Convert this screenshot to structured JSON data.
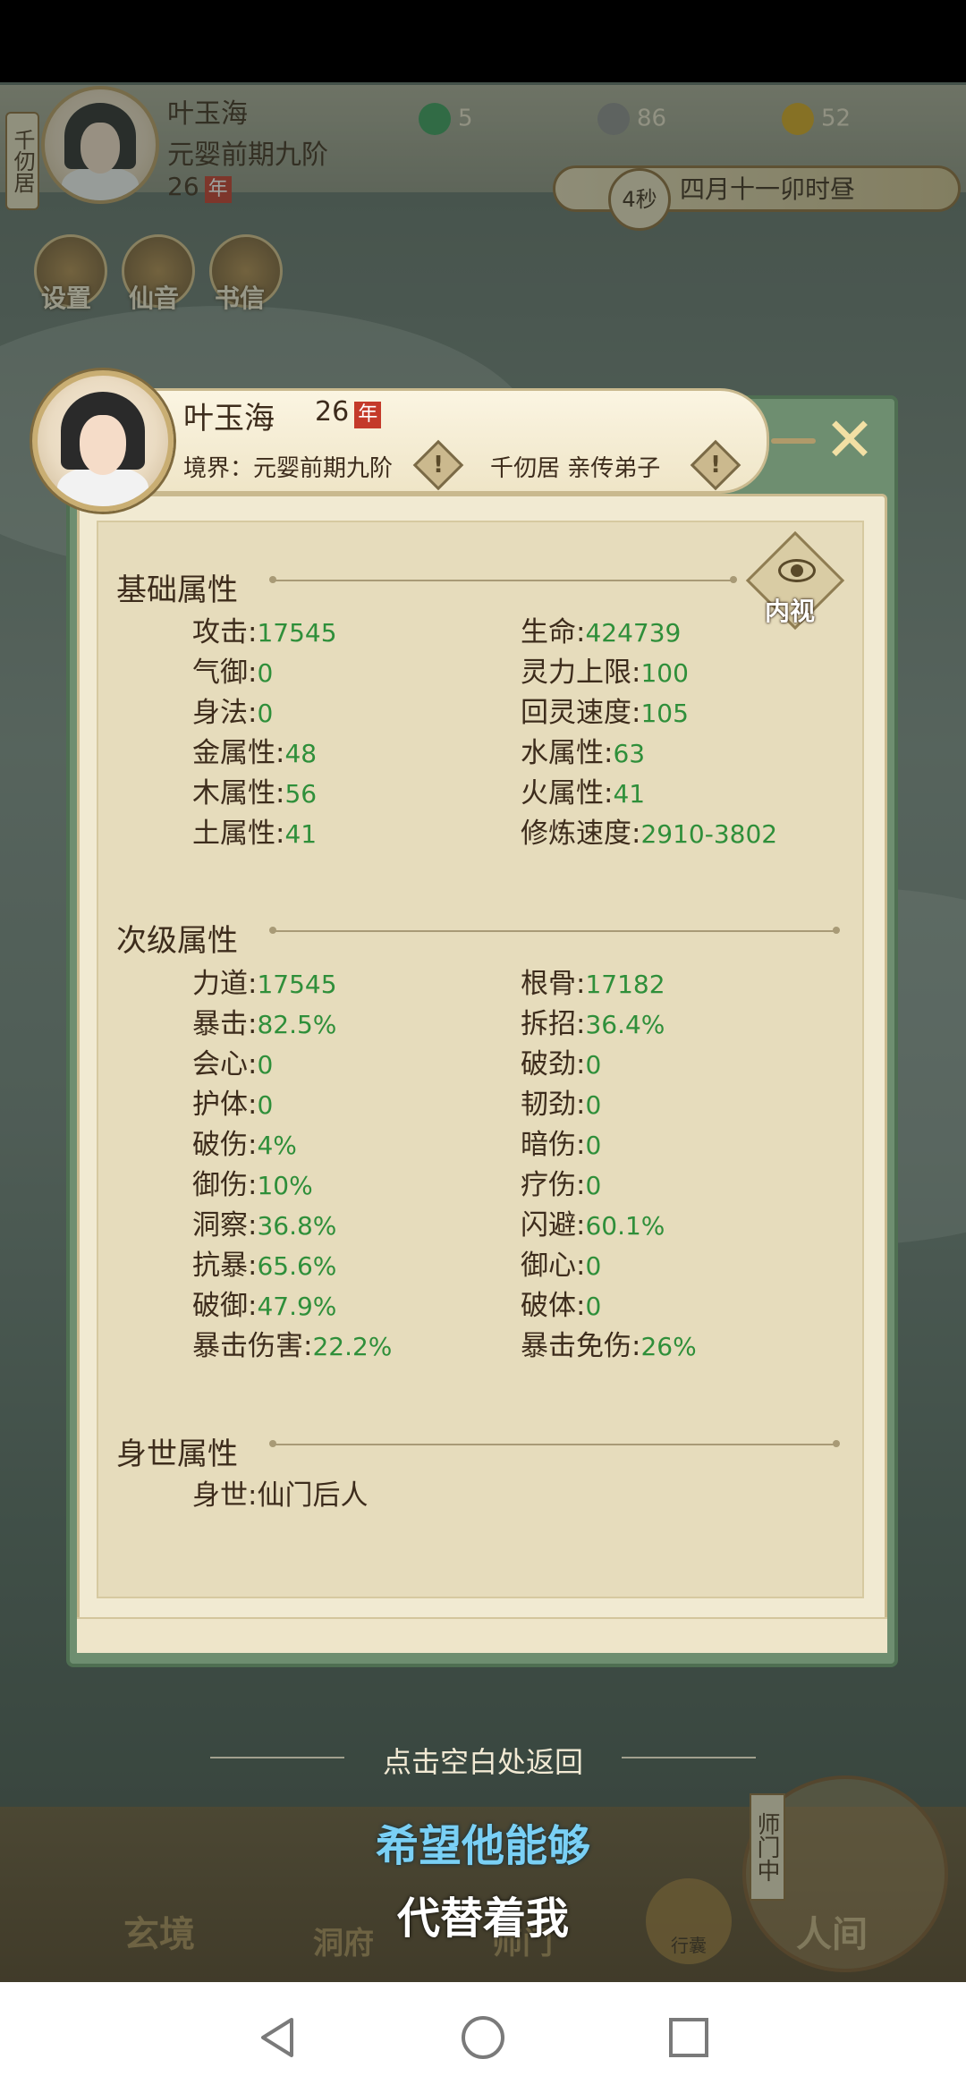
{
  "hud": {
    "sect_tag": "千仞居",
    "name": "叶玉海",
    "realm": "元婴前期九阶",
    "age": "26",
    "year_badge": "年",
    "resources": [
      {
        "icon": "jade-icon",
        "value": "5",
        "color": "#3a9a5a"
      },
      {
        "icon": "coin-icon",
        "value": "86",
        "color": "#8a8a8a"
      },
      {
        "icon": "gold-ingot-icon",
        "value": "52",
        "color": "#d4a520"
      }
    ],
    "timer": "4秒",
    "time_text": "四月十一卯时昼",
    "buttons": [
      "设置",
      "仙音",
      "书信"
    ]
  },
  "dialog": {
    "name": "叶玉海",
    "age": "26",
    "year_badge": "年",
    "realm": "境界：元婴前期九阶",
    "sect": "千仞居 亲传弟子",
    "eye_label": "内视",
    "sections": {
      "basic": {
        "title": "基础属性",
        "left": [
          {
            "label": "攻击",
            "value": "17545"
          },
          {
            "label": "气御",
            "value": "0"
          },
          {
            "label": "身法",
            "value": "0"
          },
          {
            "label": "金属性",
            "value": "48"
          },
          {
            "label": "木属性",
            "value": "56"
          },
          {
            "label": "土属性",
            "value": "41"
          }
        ],
        "right": [
          {
            "label": "生命",
            "value": "424739"
          },
          {
            "label": "灵力上限",
            "value": "100"
          },
          {
            "label": "回灵速度",
            "value": "105"
          },
          {
            "label": "水属性",
            "value": "63"
          },
          {
            "label": "火属性",
            "value": "41"
          },
          {
            "label": "修炼速度",
            "value": "2910-3802"
          }
        ]
      },
      "secondary": {
        "title": "次级属性",
        "left": [
          {
            "label": "力道",
            "value": "17545"
          },
          {
            "label": "暴击",
            "value": "82.5%"
          },
          {
            "label": "会心",
            "value": "0"
          },
          {
            "label": "护体",
            "value": "0"
          },
          {
            "label": "破伤",
            "value": "4%"
          },
          {
            "label": "御伤",
            "value": "10%"
          },
          {
            "label": "洞察",
            "value": "36.8%"
          },
          {
            "label": "抗暴",
            "value": "65.6%"
          },
          {
            "label": "破御",
            "value": "47.9%"
          },
          {
            "label": "暴击伤害",
            "value": "22.2%"
          }
        ],
        "right": [
          {
            "label": "根骨",
            "value": "17182"
          },
          {
            "label": "拆招",
            "value": "36.4%"
          },
          {
            "label": "破劲",
            "value": "0"
          },
          {
            "label": "韧劲",
            "value": "0"
          },
          {
            "label": "暗伤",
            "value": "0"
          },
          {
            "label": "疗伤",
            "value": "0"
          },
          {
            "label": "闪避",
            "value": "60.1%"
          },
          {
            "label": "御心",
            "value": "0"
          },
          {
            "label": "破体",
            "value": "0"
          },
          {
            "label": "暴击免伤",
            "value": "26%"
          }
        ]
      },
      "background": {
        "title": "身世属性",
        "items": [
          {
            "label": "身世",
            "value": "仙门后人"
          }
        ]
      }
    }
  },
  "hint": "点击空白处返回",
  "subtitles": [
    "希望他能够",
    "代替着我"
  ],
  "bottom_nav": {
    "items": [
      "玄境",
      "洞府",
      "师门",
      "人间"
    ],
    "pouch": "行囊",
    "tag": "师门中"
  },
  "colors": {
    "value_green": "#2f8f3a",
    "subtitle_blue": "#7ad0f5",
    "year_red": "#c43a2a"
  }
}
